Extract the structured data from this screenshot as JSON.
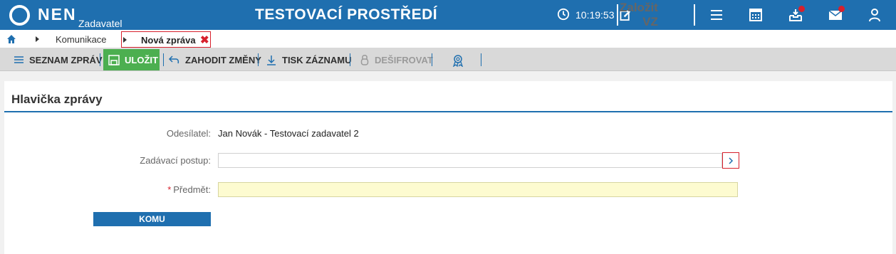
{
  "header": {
    "logo_text": "NEN",
    "logo_sub": "Zadavatel",
    "env_title": "TESTOVACÍ PROSTŘEDÍ",
    "time": "10:19:53",
    "new_vz_label": "Založit VZ",
    "icons": [
      "clock-icon",
      "edit-icon",
      "menu-icon",
      "calculator-icon",
      "inbox-icon",
      "mail-icon",
      "user-icon"
    ],
    "badge_color": "#d7202c",
    "brand_color": "#1f6faf"
  },
  "breadcrumb": {
    "home_icon": "home-icon",
    "items": [
      "Komunikace"
    ],
    "active": "Nová zpráva"
  },
  "toolbar": {
    "list_label": "SEZNAM ZPRÁV",
    "save_label": "ULOŽIT",
    "discard_label": "ZAHODIT ZMĚNY",
    "print_label": "TISK ZÁZNAMU",
    "decrypt_label": "DEŠIFROVAT",
    "save_color": "#4caf50"
  },
  "panel": {
    "title": "Hlavička zprávy",
    "sender_label": "Odesílatel:",
    "sender_value": "Jan Novák - Testovací zadavatel 2",
    "procedure_label": "Zadávací postup:",
    "procedure_value": "",
    "subject_label": "Předmět:",
    "subject_required": "*",
    "subject_value": "",
    "to_button": "KOMU"
  }
}
